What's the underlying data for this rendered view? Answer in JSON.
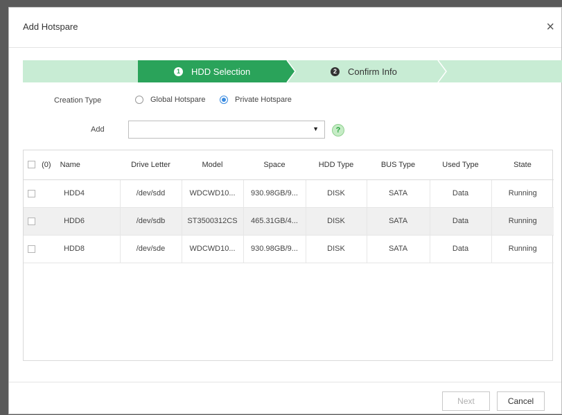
{
  "dialog": {
    "title": "Add Hotspare",
    "close_glyph": "×"
  },
  "wizard": {
    "steps": [
      {
        "number": "1",
        "label": "HDD Selection",
        "active": true
      },
      {
        "number": "2",
        "label": "Confirm Info",
        "active": false
      }
    ],
    "active_color": "#2aa35a",
    "inactive_color": "#c8ecd4"
  },
  "form": {
    "creation_type_label": "Creation Type",
    "options": [
      {
        "label": "Global Hotspare",
        "selected": false
      },
      {
        "label": "Private Hotspare",
        "selected": true
      }
    ],
    "add_label": "Add",
    "add_value": "",
    "help_glyph": "?"
  },
  "table": {
    "selected_count": "(0)",
    "columns": [
      "Name",
      "Drive Letter",
      "Model",
      "Space",
      "HDD Type",
      "BUS Type",
      "Used Type",
      "State"
    ],
    "rows": [
      [
        "HDD4",
        "/dev/sdd",
        "WDCWD10...",
        "930.98GB/9...",
        "DISK",
        "SATA",
        "Data",
        "Running"
      ],
      [
        "HDD6",
        "/dev/sdb",
        "ST3500312CS",
        "465.31GB/4...",
        "DISK",
        "SATA",
        "Data",
        "Running"
      ],
      [
        "HDD8",
        "/dev/sde",
        "WDCWD10...",
        "930.98GB/9...",
        "DISK",
        "SATA",
        "Data",
        "Running"
      ]
    ]
  },
  "footer": {
    "next_label": "Next",
    "cancel_label": "Cancel"
  }
}
